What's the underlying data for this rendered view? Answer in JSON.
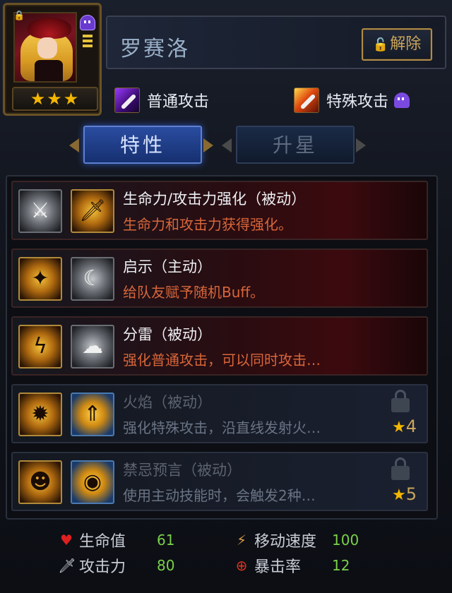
{
  "hero": {
    "name": "罗赛洛",
    "stars": "★★★",
    "release_label": "解除"
  },
  "attacks": {
    "normal": "普通攻击",
    "special": "特殊攻击"
  },
  "tabs": {
    "traits": "特性",
    "star_up": "升星"
  },
  "skills": [
    {
      "title": "生命力/攻击力强化（被动）",
      "desc": "生命力和攻击力获得强化。",
      "locked": false
    },
    {
      "title": "启示（主动）",
      "desc": "给队友赋予随机Buff。",
      "locked": false
    },
    {
      "title": "分雷（被动）",
      "desc": "强化普通攻击，可以同时攻击…",
      "locked": false
    },
    {
      "title": "火焰（被动）",
      "desc": "强化特殊攻击，沿直线发射火…",
      "locked": true,
      "star_req": "4"
    },
    {
      "title": "禁忌预言（被动）",
      "desc": "使用主动技能时，会触发2种…",
      "locked": true,
      "star_req": "5"
    }
  ],
  "stats": {
    "hp_label": "生命值",
    "hp": "61",
    "atk_label": "攻击力",
    "atk": "80",
    "speed_label": "移动速度",
    "speed": "100",
    "crit_label": "暴击率",
    "crit": "12"
  },
  "icons": [
    "lock-icon",
    "ghost-icon",
    "unlock-icon",
    "sword-icon",
    "heart-icon",
    "boot-icon",
    "crosshair-icon",
    "star-icon"
  ],
  "colors": {
    "stat_value": "#7ad04a",
    "skill_desc": "#d8663a",
    "star": "#f5b700",
    "tab_active": "#2a4ca0"
  }
}
